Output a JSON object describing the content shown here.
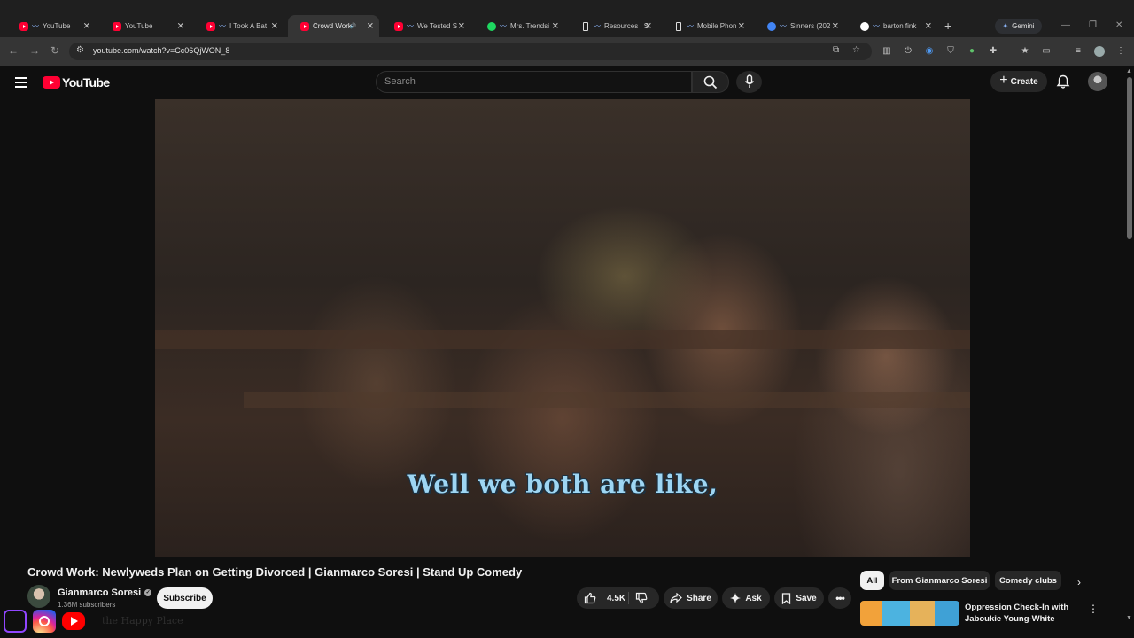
{
  "browser": {
    "tabs": [
      {
        "label": "YouTube",
        "favicon": "youtube-icon"
      },
      {
        "label": "YouTube",
        "favicon": "youtube-icon"
      },
      {
        "label": "I Took A Bat",
        "favicon": "youtube-icon"
      },
      {
        "label": "Crowd Work",
        "favicon": "youtube-icon",
        "active": true,
        "audio": true
      },
      {
        "label": "We Tested S",
        "favicon": "youtube-icon"
      },
      {
        "label": "Mrs. Trendsi",
        "favicon": "spotify-icon"
      },
      {
        "label": "Resources | S",
        "favicon": "phone-icon"
      },
      {
        "label": "Mobile Phon",
        "favicon": "phone-icon"
      },
      {
        "label": "Sinners (202",
        "favicon": "globe-icon"
      },
      {
        "label": "barton fink",
        "favicon": "google-icon"
      }
    ],
    "gemini_label": "Gemini",
    "url": "youtube.com/watch?v=Cc06QjWON_8"
  },
  "youtube": {
    "logo_text": "YouTube",
    "search_placeholder": "Search",
    "create_label": "Create"
  },
  "video": {
    "caption": "Well we both are like,",
    "title": "Crowd Work: Newlyweds Plan on Getting Divorced | Gianmarco Soresi | Stand Up Comedy",
    "channel": "Gianmarco Soresi",
    "subscribers": "1.36M subscribers",
    "subscribe_label": "Subscribe",
    "likes": "4.5K",
    "share_label": "Share",
    "ask_label": "Ask",
    "save_label": "Save"
  },
  "sidebar": {
    "chips": [
      "All",
      "From Gianmarco Soresi",
      "Comedy clubs"
    ],
    "recommendation_title": "Oppression Check-In with Jaboukie Young-White"
  },
  "overlay": {
    "ghost_text": "the Happy Place"
  },
  "colors": {
    "youtube_red": "#ff0033",
    "caption_blue": "#9ed6f3",
    "page_bg": "#0f0f0f"
  }
}
